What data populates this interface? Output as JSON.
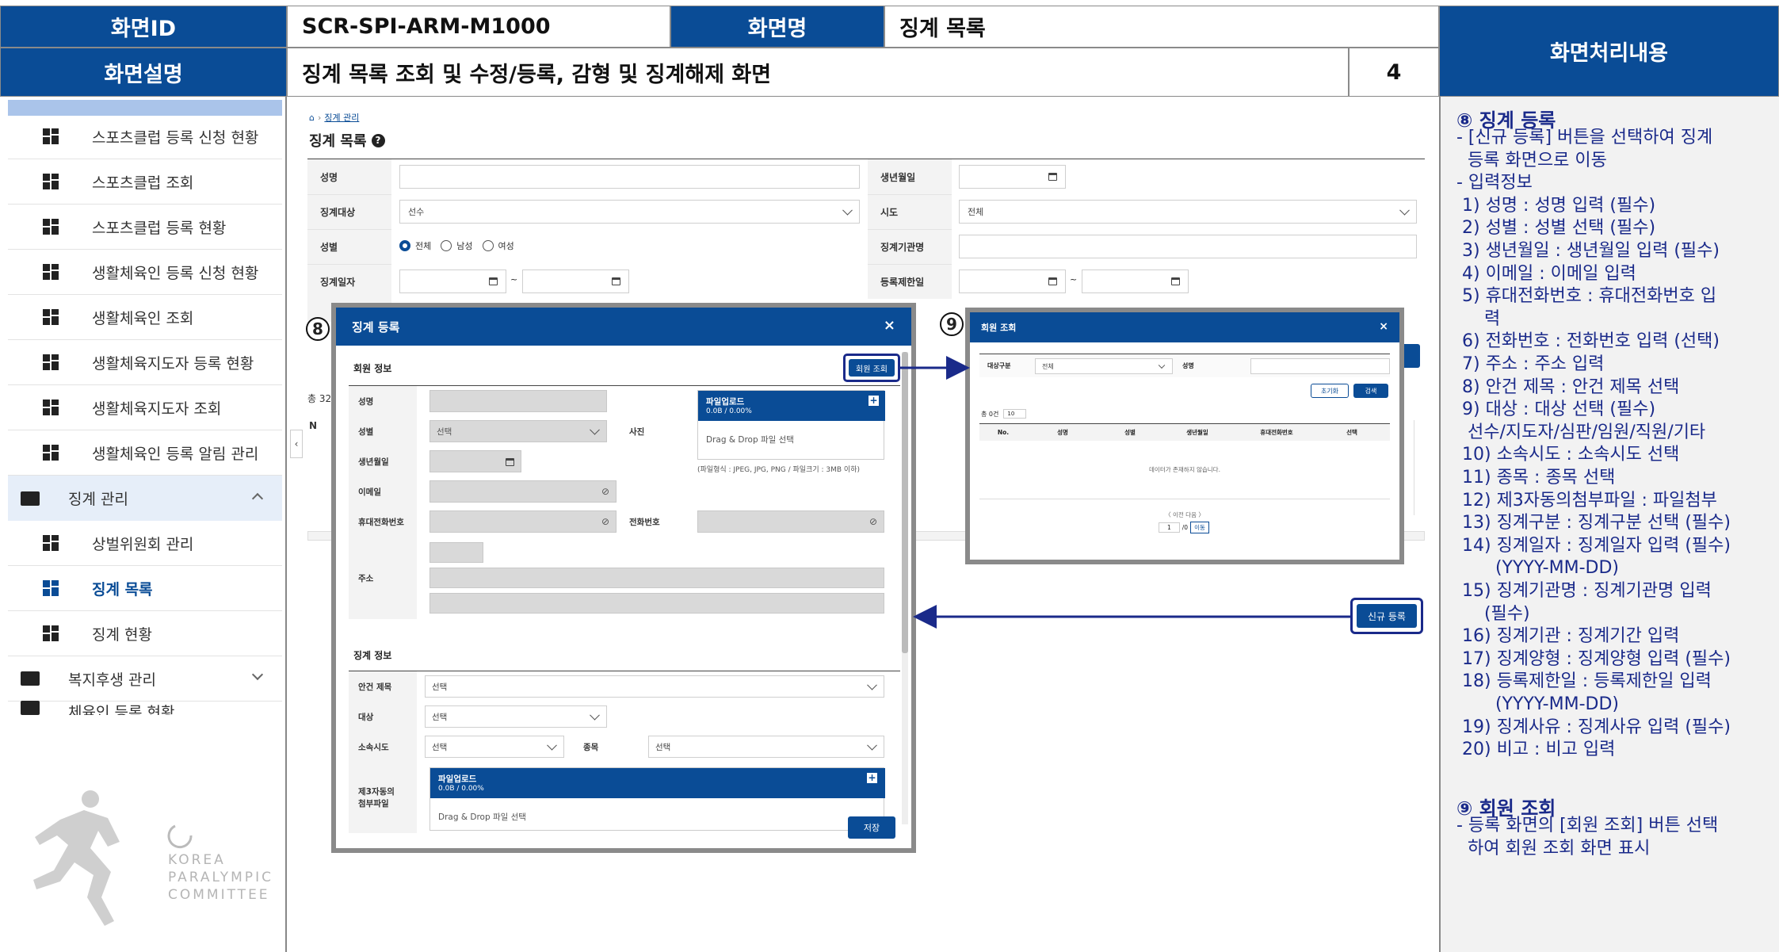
{
  "header": {
    "screen_id_label": "화면ID",
    "screen_id": "SCR-SPI-ARM-M1000",
    "screen_name_label": "화면명",
    "screen_name": "징계 목록",
    "desc_label": "화면설명",
    "desc": "징계 목록 조회 및 수정/등록, 감형 및 징계해제 화면",
    "page_no": "4",
    "processing_label": "화면처리내용"
  },
  "sidebar": {
    "items": [
      {
        "label": "스포츠클럽 등록 신청 현황"
      },
      {
        "label": "스포츠클럽 조회"
      },
      {
        "label": "스포츠클럽 등록 현황"
      },
      {
        "label": "생활체육인 등록 신청 현황"
      },
      {
        "label": "생활체육인 조회"
      },
      {
        "label": "생활체육지도자 등록 현황"
      },
      {
        "label": "생활체육지도자 조회"
      },
      {
        "label": "생활체육인 등록 알림 관리"
      }
    ],
    "group_discipline": "징계 관리",
    "sub_items": [
      {
        "label": "상벌위원회 관리"
      },
      {
        "label": "징계 목록"
      },
      {
        "label": "징계 현황"
      }
    ],
    "group_welfare": "복지후생 관리",
    "group_partial": "체육인 등록 현황",
    "logo": {
      "line1": "KOREA",
      "line2": "PARALYMPIC",
      "line3": "COMMITTEE"
    }
  },
  "main": {
    "breadcrumb": "징계 관리",
    "title": "징계 목록",
    "form": {
      "name_label": "성명",
      "birth_label": "생년월일",
      "target_label": "징계대상",
      "target_value": "선수",
      "sido_label": "시도",
      "sido_value": "전체",
      "gender_label": "성별",
      "gender_all": "전체",
      "gender_male": "남성",
      "gender_female": "여성",
      "agency_label": "징계기관명",
      "date_label": "징계일자",
      "limit_label": "등록제한일",
      "tilde": "~"
    },
    "total_prefix": "총 32",
    "new_button": "신규 등록",
    "table_hint": "N"
  },
  "modal_register": {
    "marker": "8",
    "title": "징계 등록",
    "section_member": "회원 정보",
    "lookup_button": "회원 조회",
    "name_label": "성명",
    "gender_label": "성별",
    "gender_value": "선택",
    "photo_label": "사진",
    "birth_label": "생년월일",
    "email_label": "이메일",
    "mobile_label": "휴대전화번호",
    "phone_label": "전화번호",
    "address_label": "주소",
    "upload_title": "파일업로드",
    "upload_size": "0.0B / 0.00%",
    "upload_drop": "Drag & Drop 파일 선택",
    "upload_hint": "(파일형식 : JPEG, JPG, PNG / 파일크기 : 3MB 이하)",
    "section_discipline": "징계 정보",
    "case_label": "안건 제목",
    "case_value": "선택",
    "target_label": "대상",
    "target_value": "선택",
    "sido_label": "소속시도",
    "sido_value": "선택",
    "sport_label": "종목",
    "sport_value": "선택",
    "consent_label_1": "제3자동의",
    "consent_label_2": "첨부파일",
    "save_button": "저장"
  },
  "modal_lookup": {
    "marker": "9",
    "title": "회원 조회",
    "type_label": "대상구분",
    "type_value": "전체",
    "name_label": "성명",
    "reset_button": "초기화",
    "search_button": "검색",
    "count": "총 0건",
    "page_size": "10",
    "columns": [
      "No.",
      "성명",
      "성별",
      "생년월일",
      "휴대전화번호",
      "선택"
    ],
    "empty": "데이터가 존재하지 않습니다.",
    "pager": "〈 이전   다음 〉",
    "page_input": "1",
    "page_total": "/0",
    "go_button": "이동"
  },
  "panel": {
    "s8_title": "⑧ 징계 등록",
    "s8_lines": [
      "- [신규 등록] 버튼을 선택하여 징계",
      "  등록 화면으로 이동",
      "- 입력정보",
      " 1) 성명 : 성명 입력 (필수)",
      " 2) 성별 : 성별 선택 (필수)",
      " 3) 생년월일 : 생년월일 입력 (필수)",
      " 4) 이메일 : 이메일 입력",
      " 5) 휴대전화번호 : 휴대전화번호 입",
      "     력",
      " 6) 전화번호 : 전화번호 입력 (선택)",
      " 7) 주소 : 주소 입력",
      " 8) 안건 제목 : 안건 제목 선택",
      " 9) 대상 : 대상 선택 (필수)",
      "  선수/지도자/심판/임원/직원/기타",
      " 10) 소속시도 : 소속시도 선택",
      " 11) 종목 : 종목 선택",
      " 12) 제3자동의첨부파일 : 파일첨부",
      " 13) 징계구분 : 징계구분 선택 (필수)",
      " 14) 징계일자 : 징계일자 입력 (필수)",
      "       (YYYY-MM-DD)",
      " 15) 징계기관명 : 징계기관명 입력",
      "     (필수)",
      " 16) 징계기관 : 징계기간 입력",
      " 17) 징계양형 : 징계양형 입력 (필수)",
      " 18) 등록제한일 : 등록제한일 입력",
      "       (YYYY-MM-DD)",
      " 19) 징계사유 : 징계사유 입력 (필수)",
      " 20) 비고 : 비고 입력"
    ],
    "s9_title": "⑨ 회원 조회",
    "s9_lines": [
      "- 등록 화면의 [회원 조회] 버튼 선택",
      "  하여 회원 조회 화면 표시"
    ]
  },
  "colors": {
    "brand": "#0a4c96",
    "annotation": "#1a2a8a"
  }
}
